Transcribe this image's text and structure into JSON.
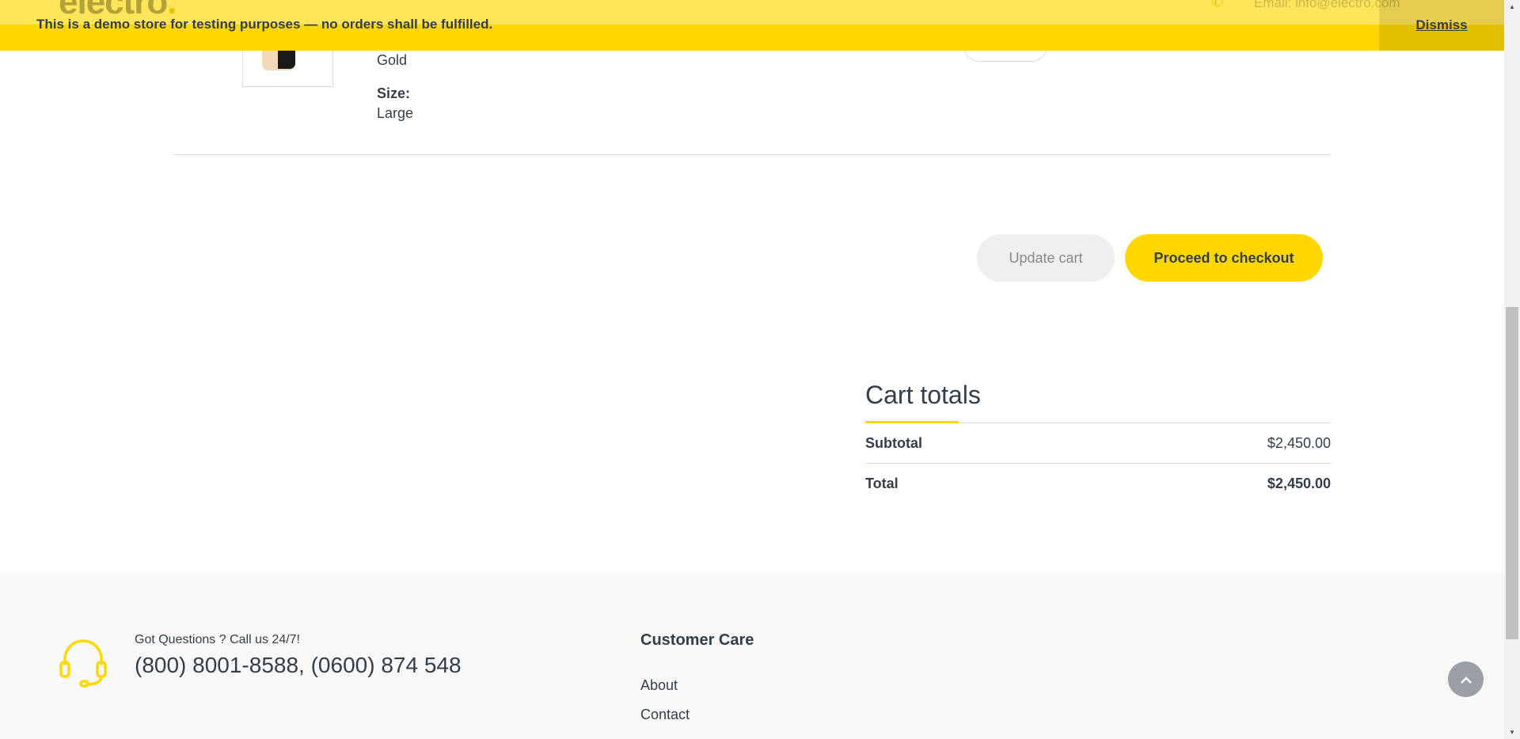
{
  "demo_banner": {
    "notice": "This is a demo store for testing purposes — no orders shall be fulfilled.",
    "dismiss_label": "Dismiss",
    "ghost_logo_text": "electro",
    "ghost_logo_dot": ".",
    "ghost_email": "Email: info@electro.com"
  },
  "cart_item": {
    "color_value": "Gold",
    "size_label": "Size:",
    "size_value": "Large"
  },
  "actions": {
    "update_cart_label": "Update cart",
    "checkout_label": "Proceed to checkout"
  },
  "cart_totals": {
    "heading": "Cart totals",
    "subtotal_label": "Subtotal",
    "subtotal_value": "$2,450.00",
    "total_label": "Total",
    "total_value": "$2,450.00"
  },
  "footer": {
    "support_label": "Got Questions ? Call us 24/7!",
    "support_phone": "(800) 8001-8588, (0600) 874 548",
    "customer_care_heading": "Customer Care",
    "customer_care_links": [
      "About",
      "Contact"
    ]
  },
  "colors": {
    "accent": "#fed700",
    "text": "#333e48",
    "footer_bg": "#f8f8f8"
  },
  "icons": {
    "support": "headset-icon",
    "back_to_top": "chevron-up-icon",
    "ghost_header": "phone-icon"
  }
}
